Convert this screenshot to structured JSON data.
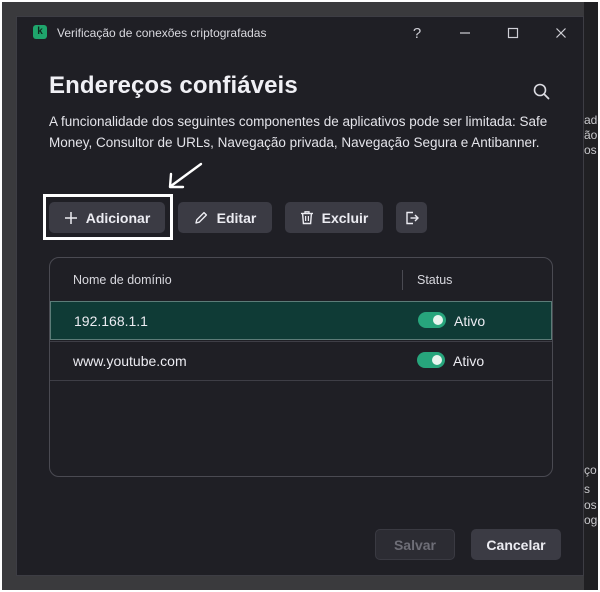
{
  "window": {
    "title": "Verificação de conexões criptografadas",
    "logo_letter": "k",
    "controls": {
      "help": "?",
      "minimize": "—",
      "close": "✕"
    }
  },
  "page": {
    "title": "Endereços confiáveis",
    "description": "A funcionalidade dos seguintes componentes de aplicativos pode ser limitada: Safe Money, Consultor de URLs, Navegação privada, Navegação Segura e Antibanner."
  },
  "toolbar": {
    "add_label": "Adicionar",
    "edit_label": "Editar",
    "delete_label": "Excluir"
  },
  "table": {
    "columns": [
      "Nome de domínio",
      "Status"
    ],
    "rows": [
      {
        "domain": "192.168.1.1",
        "status": "Ativo",
        "enabled": true,
        "selected": true
      },
      {
        "domain": "www.youtube.com",
        "status": "Ativo",
        "enabled": true,
        "selected": false
      }
    ]
  },
  "footer": {
    "save_label": "Salvar",
    "cancel_label": "Cancelar"
  },
  "background": {
    "fragments": [
      "ade",
      "ão",
      "os",
      "ço",
      "s",
      "os",
      "ogo"
    ]
  },
  "colors": {
    "accent_green": "#27a57c",
    "selected_row": "#0f3b36",
    "window_bg": "#1f1f25"
  }
}
